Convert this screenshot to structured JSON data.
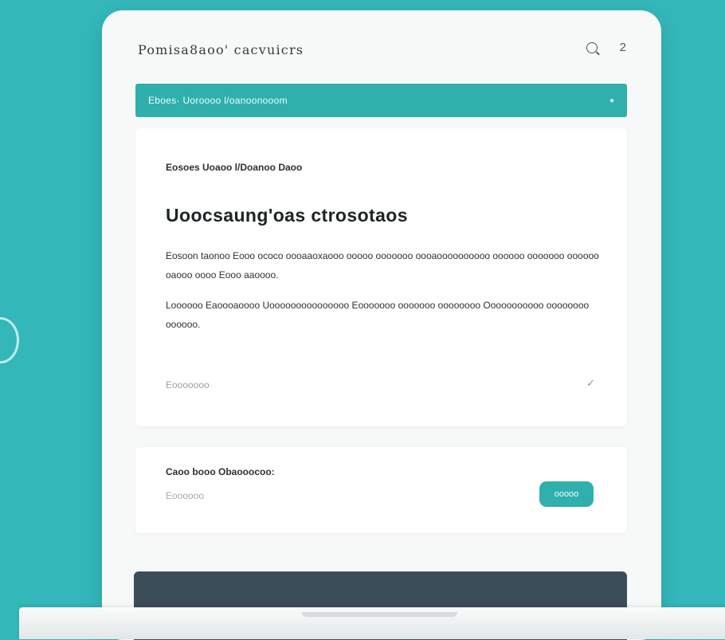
{
  "window": {
    "title": "Pomisa8aoo' cacvuicrs",
    "notification_count": "2"
  },
  "banner": {
    "text": "Eboes· Uoroooo l/oanoonooom"
  },
  "article": {
    "eyebrow": "Eosoes Uoaoo l/Doanoo Daoo",
    "heading": "Uoocsaung'oas ctrosotaos",
    "paragraph_1": "Eosoon taonoo Eooo ococo oooaaoxaooo ooooo ooooooo oooaoooooooooo oooooo ooooooo oooooo oaooo oooo Eooo aaoooo.",
    "paragraph_2": "Loooooo Eaoooaoooo Uooooooooooooooo Eooooooo ooooooo oooooooo Ooooooooooo oooooooo oooooo.",
    "footer_label": "Eooooooo"
  },
  "subscribe": {
    "title": "Caoo booo Obaooocoo:",
    "caption": "Eoooooo",
    "button_label": "ooooo"
  },
  "colors": {
    "background": "#33b7b9",
    "accent": "#2fb0ac",
    "dark_bar": "#3c4d5a"
  },
  "icons": {
    "search": "search-icon",
    "check": "check-icon"
  }
}
